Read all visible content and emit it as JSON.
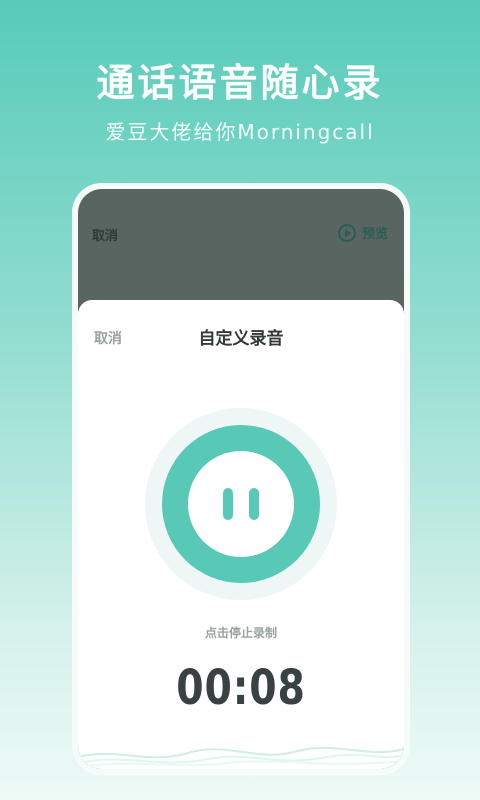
{
  "promo": {
    "headline": "通话语音随心录",
    "subline": "爱豆大佬给你Morningcall"
  },
  "background_screen": {
    "cancel_label": "取消",
    "preview_label": "预览"
  },
  "sheet": {
    "cancel_label": "取消",
    "title": "自定义录音",
    "hint": "点击停止录制",
    "timer": "00:08"
  },
  "colors": {
    "accent": "#58c9b6",
    "timer_text": "#3a4142"
  },
  "icons": {
    "preview": "play-circle-icon",
    "record": "pause-icon",
    "decoration": "wave-icon"
  }
}
